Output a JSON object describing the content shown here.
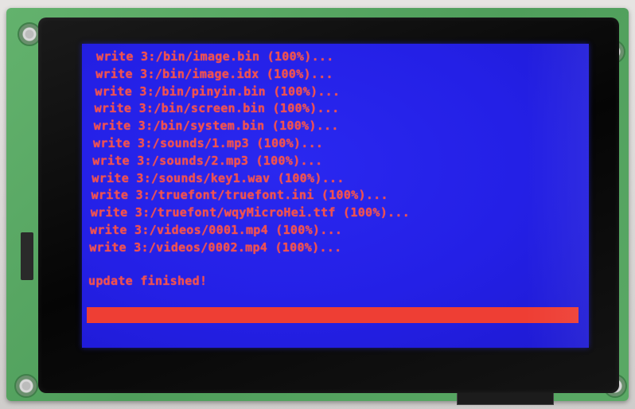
{
  "screen": {
    "log_lines": [
      "write 3:/bin/image.bin (100%)...",
      "write 3:/bin/image.idx (100%)...",
      "write 3:/bin/pinyin.bin (100%)...",
      "write 3:/bin/screen.bin (100%)...",
      "write 3:/bin/system.bin (100%)...",
      "write 3:/sounds/1.mp3 (100%)...",
      "write 3:/sounds/2.mp3 (100%)...",
      "write 3:/sounds/key1.wav (100%)...",
      "write 3:/truefont/truefont.ini (100%)...",
      "write 3:/truefont/wqyMicroHei.ttf (100%)...",
      "write 3:/videos/0001.mp4 (100%)...",
      "write 3:/videos/0002.mp4 (100%)..."
    ],
    "status": "update finished!",
    "progress_percent": 100
  },
  "colors": {
    "screen_blue": "#2420e6",
    "text_red": "#f2504c",
    "progress_red": "#ee3e34",
    "pcb_green": "#5aa965",
    "bezel_black": "#0a0a0a"
  }
}
